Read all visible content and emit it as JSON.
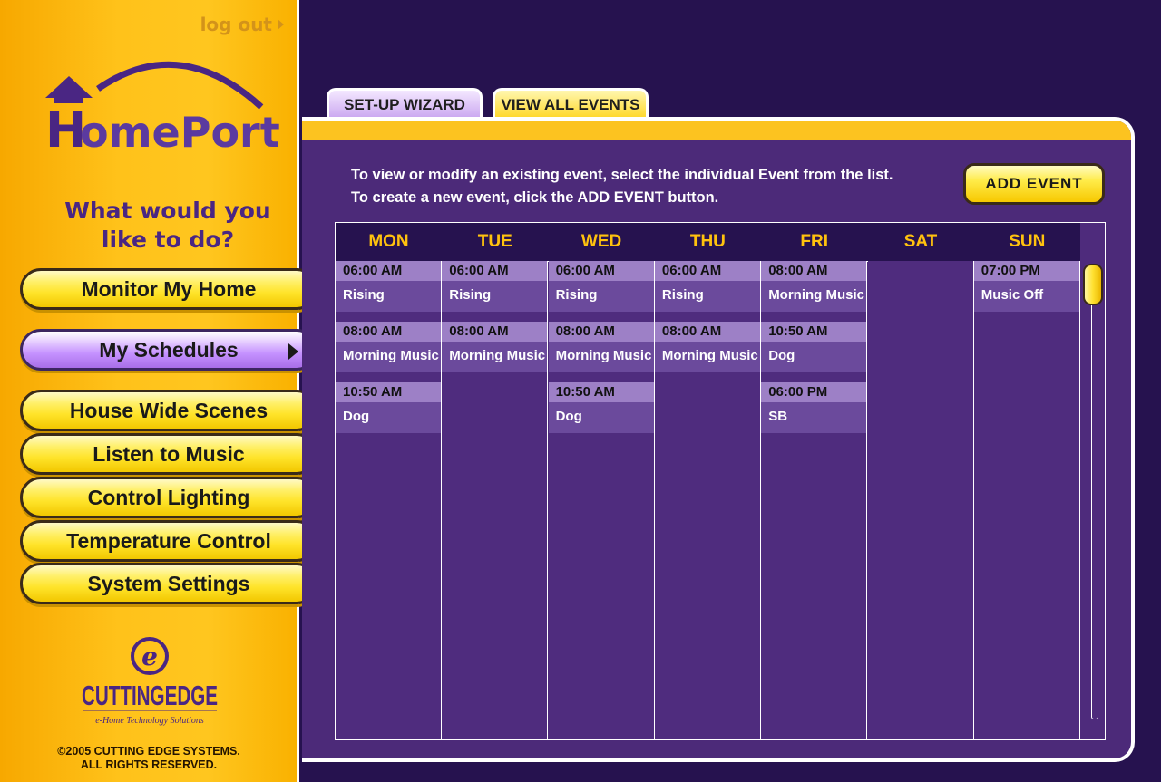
{
  "header": {
    "logout_label": "log out"
  },
  "brand": {
    "logo_text_h": "H",
    "logo_text_rest": "omePort",
    "company_name": "CUTTINGEDGE",
    "company_tagline": "e-Home Technology Solutions"
  },
  "sidebar": {
    "question_line1": "What would you",
    "question_line2": "like to do?",
    "items": [
      {
        "label": "Monitor My Home"
      },
      {
        "label": "My Schedules"
      },
      {
        "label": "House Wide Scenes"
      },
      {
        "label": "Listen to Music"
      },
      {
        "label": "Control Lighting"
      },
      {
        "label": "Temperature Control"
      },
      {
        "label": "System Settings"
      }
    ],
    "copyright_line1": "©2005 CUTTING EDGE SYSTEMS.",
    "copyright_line2": "ALL RIGHTS RESERVED."
  },
  "tabs": [
    {
      "label": "SET-UP WIZARD"
    },
    {
      "label": "VIEW ALL EVENTS"
    }
  ],
  "main": {
    "instruction_line1": "To view or modify an existing event, select the individual Event from the list.",
    "instruction_line2": "To create a new event, click the ADD EVENT button.",
    "add_event_label": "ADD EVENT"
  },
  "schedule": {
    "days": [
      "MON",
      "TUE",
      "WED",
      "THU",
      "FRI",
      "SAT",
      "SUN"
    ],
    "events": [
      [
        {
          "time": "06:00 AM",
          "name": "Rising"
        },
        {
          "time": "08:00 AM",
          "name": "Morning Music"
        },
        {
          "time": "10:50 AM",
          "name": "Dog"
        }
      ],
      [
        {
          "time": "06:00 AM",
          "name": "Rising"
        },
        {
          "time": "08:00 AM",
          "name": "Morning Music"
        }
      ],
      [
        {
          "time": "06:00 AM",
          "name": "Rising"
        },
        {
          "time": "08:00 AM",
          "name": "Morning Music"
        },
        {
          "time": "10:50 AM",
          "name": "Dog"
        }
      ],
      [
        {
          "time": "06:00 AM",
          "name": "Rising"
        },
        {
          "time": "08:00 AM",
          "name": "Morning Music"
        }
      ],
      [
        {
          "time": "08:00 AM",
          "name": "Morning Music"
        },
        {
          "time": "10:50 AM",
          "name": "Dog"
        },
        {
          "time": "06:00 PM",
          "name": "SB"
        }
      ],
      [],
      [
        {
          "time": "07:00 PM",
          "name": "Music Off"
        }
      ]
    ]
  },
  "colors": {
    "accent_yellow": "#ffc20e",
    "brand_purple": "#4a2683",
    "panel_purple": "#4c2a79",
    "background": "#26124f"
  }
}
